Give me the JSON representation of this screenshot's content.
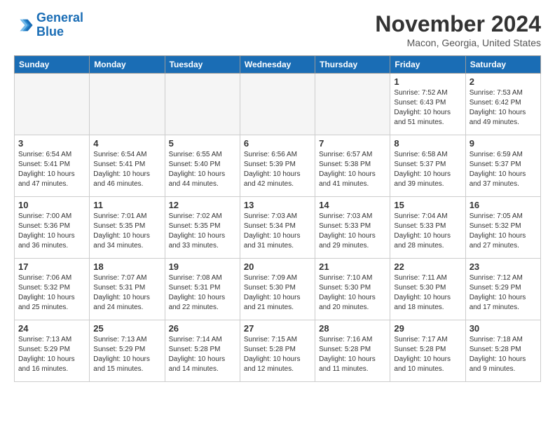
{
  "header": {
    "logo_line1": "General",
    "logo_line2": "Blue",
    "month_title": "November 2024",
    "location": "Macon, Georgia, United States"
  },
  "weekdays": [
    "Sunday",
    "Monday",
    "Tuesday",
    "Wednesday",
    "Thursday",
    "Friday",
    "Saturday"
  ],
  "weeks": [
    [
      {
        "day": "",
        "info": ""
      },
      {
        "day": "",
        "info": ""
      },
      {
        "day": "",
        "info": ""
      },
      {
        "day": "",
        "info": ""
      },
      {
        "day": "",
        "info": ""
      },
      {
        "day": "1",
        "info": "Sunrise: 7:52 AM\nSunset: 6:43 PM\nDaylight: 10 hours and 51 minutes."
      },
      {
        "day": "2",
        "info": "Sunrise: 7:53 AM\nSunset: 6:42 PM\nDaylight: 10 hours and 49 minutes."
      }
    ],
    [
      {
        "day": "3",
        "info": "Sunrise: 6:54 AM\nSunset: 5:41 PM\nDaylight: 10 hours and 47 minutes."
      },
      {
        "day": "4",
        "info": "Sunrise: 6:54 AM\nSunset: 5:41 PM\nDaylight: 10 hours and 46 minutes."
      },
      {
        "day": "5",
        "info": "Sunrise: 6:55 AM\nSunset: 5:40 PM\nDaylight: 10 hours and 44 minutes."
      },
      {
        "day": "6",
        "info": "Sunrise: 6:56 AM\nSunset: 5:39 PM\nDaylight: 10 hours and 42 minutes."
      },
      {
        "day": "7",
        "info": "Sunrise: 6:57 AM\nSunset: 5:38 PM\nDaylight: 10 hours and 41 minutes."
      },
      {
        "day": "8",
        "info": "Sunrise: 6:58 AM\nSunset: 5:37 PM\nDaylight: 10 hours and 39 minutes."
      },
      {
        "day": "9",
        "info": "Sunrise: 6:59 AM\nSunset: 5:37 PM\nDaylight: 10 hours and 37 minutes."
      }
    ],
    [
      {
        "day": "10",
        "info": "Sunrise: 7:00 AM\nSunset: 5:36 PM\nDaylight: 10 hours and 36 minutes."
      },
      {
        "day": "11",
        "info": "Sunrise: 7:01 AM\nSunset: 5:35 PM\nDaylight: 10 hours and 34 minutes."
      },
      {
        "day": "12",
        "info": "Sunrise: 7:02 AM\nSunset: 5:35 PM\nDaylight: 10 hours and 33 minutes."
      },
      {
        "day": "13",
        "info": "Sunrise: 7:03 AM\nSunset: 5:34 PM\nDaylight: 10 hours and 31 minutes."
      },
      {
        "day": "14",
        "info": "Sunrise: 7:03 AM\nSunset: 5:33 PM\nDaylight: 10 hours and 29 minutes."
      },
      {
        "day": "15",
        "info": "Sunrise: 7:04 AM\nSunset: 5:33 PM\nDaylight: 10 hours and 28 minutes."
      },
      {
        "day": "16",
        "info": "Sunrise: 7:05 AM\nSunset: 5:32 PM\nDaylight: 10 hours and 27 minutes."
      }
    ],
    [
      {
        "day": "17",
        "info": "Sunrise: 7:06 AM\nSunset: 5:32 PM\nDaylight: 10 hours and 25 minutes."
      },
      {
        "day": "18",
        "info": "Sunrise: 7:07 AM\nSunset: 5:31 PM\nDaylight: 10 hours and 24 minutes."
      },
      {
        "day": "19",
        "info": "Sunrise: 7:08 AM\nSunset: 5:31 PM\nDaylight: 10 hours and 22 minutes."
      },
      {
        "day": "20",
        "info": "Sunrise: 7:09 AM\nSunset: 5:30 PM\nDaylight: 10 hours and 21 minutes."
      },
      {
        "day": "21",
        "info": "Sunrise: 7:10 AM\nSunset: 5:30 PM\nDaylight: 10 hours and 20 minutes."
      },
      {
        "day": "22",
        "info": "Sunrise: 7:11 AM\nSunset: 5:30 PM\nDaylight: 10 hours and 18 minutes."
      },
      {
        "day": "23",
        "info": "Sunrise: 7:12 AM\nSunset: 5:29 PM\nDaylight: 10 hours and 17 minutes."
      }
    ],
    [
      {
        "day": "24",
        "info": "Sunrise: 7:13 AM\nSunset: 5:29 PM\nDaylight: 10 hours and 16 minutes."
      },
      {
        "day": "25",
        "info": "Sunrise: 7:13 AM\nSunset: 5:29 PM\nDaylight: 10 hours and 15 minutes."
      },
      {
        "day": "26",
        "info": "Sunrise: 7:14 AM\nSunset: 5:28 PM\nDaylight: 10 hours and 14 minutes."
      },
      {
        "day": "27",
        "info": "Sunrise: 7:15 AM\nSunset: 5:28 PM\nDaylight: 10 hours and 12 minutes."
      },
      {
        "day": "28",
        "info": "Sunrise: 7:16 AM\nSunset: 5:28 PM\nDaylight: 10 hours and 11 minutes."
      },
      {
        "day": "29",
        "info": "Sunrise: 7:17 AM\nSunset: 5:28 PM\nDaylight: 10 hours and 10 minutes."
      },
      {
        "day": "30",
        "info": "Sunrise: 7:18 AM\nSunset: 5:28 PM\nDaylight: 10 hours and 9 minutes."
      }
    ]
  ]
}
